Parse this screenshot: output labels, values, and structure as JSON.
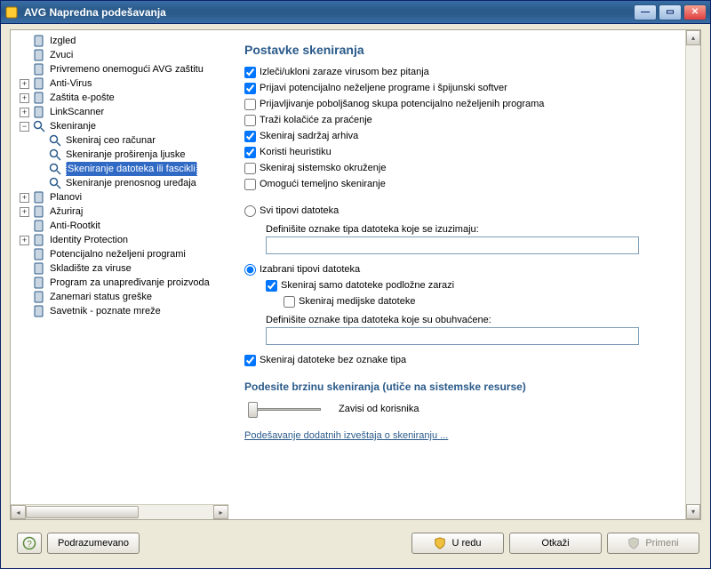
{
  "window": {
    "title": "AVG Napredna podešavanja"
  },
  "tree": [
    {
      "label": "Izgled",
      "depth": 0,
      "twisty": "",
      "icon": "doc"
    },
    {
      "label": "Zvuci",
      "depth": 0,
      "twisty": "",
      "icon": "doc"
    },
    {
      "label": "Privremeno onemogući AVG zaštitu",
      "depth": 0,
      "twisty": "",
      "icon": "doc"
    },
    {
      "label": "Anti-Virus",
      "depth": 0,
      "twisty": "+",
      "icon": "doc"
    },
    {
      "label": "Zaštita e-pošte",
      "depth": 0,
      "twisty": "+",
      "icon": "doc"
    },
    {
      "label": "LinkScanner",
      "depth": 0,
      "twisty": "+",
      "icon": "doc"
    },
    {
      "label": "Skeniranje",
      "depth": 0,
      "twisty": "−",
      "icon": "mag"
    },
    {
      "label": "Skeniraj ceo računar",
      "depth": 1,
      "twisty": "",
      "icon": "mag"
    },
    {
      "label": "Skeniranje proširenja ljuske",
      "depth": 1,
      "twisty": "",
      "icon": "mag"
    },
    {
      "label": "Skeniranje datoteka ili fascikli",
      "depth": 1,
      "twisty": "",
      "icon": "mag",
      "selected": true
    },
    {
      "label": "Skeniranje prenosnog uređaja",
      "depth": 1,
      "twisty": "",
      "icon": "mag"
    },
    {
      "label": "Planovi",
      "depth": 0,
      "twisty": "+",
      "icon": "doc"
    },
    {
      "label": "Ažuriraj",
      "depth": 0,
      "twisty": "+",
      "icon": "doc"
    },
    {
      "label": "Anti-Rootkit",
      "depth": 0,
      "twisty": "",
      "icon": "doc"
    },
    {
      "label": "Identity Protection",
      "depth": 0,
      "twisty": "+",
      "icon": "doc"
    },
    {
      "label": "Potencijalno neželjeni programi",
      "depth": 0,
      "twisty": "",
      "icon": "doc"
    },
    {
      "label": "Skladište za viruse",
      "depth": 0,
      "twisty": "",
      "icon": "doc"
    },
    {
      "label": "Program za unapređivanje proizvoda",
      "depth": 0,
      "twisty": "",
      "icon": "doc"
    },
    {
      "label": "Zanemari status greške",
      "depth": 0,
      "twisty": "",
      "icon": "doc"
    },
    {
      "label": "Savetnik - poznate mreže",
      "depth": 0,
      "twisty": "",
      "icon": "doc"
    }
  ],
  "settings": {
    "heading": "Postavke skeniranja",
    "checks": [
      {
        "label": "Izleči/ukloni zaraze virusom bez pitanja",
        "checked": true
      },
      {
        "label": "Prijavi potencijalno neželjene programe i špijunski softver",
        "checked": true
      },
      {
        "label": "Prijavljivanje poboljšanog skupa potencijalno neželjenih programa",
        "checked": false
      },
      {
        "label": "Traži kolačiće za praćenje",
        "checked": false
      },
      {
        "label": "Skeniraj sadržaj arhiva",
        "checked": true
      },
      {
        "label": "Koristi heuristiku",
        "checked": true
      },
      {
        "label": "Skeniraj sistemsko okruženje",
        "checked": false
      },
      {
        "label": "Omogući temeljno skeniranje",
        "checked": false
      }
    ],
    "radio_all": {
      "label": "Svi tipovi datoteka",
      "checked": false,
      "sublabel": "Definišite oznake tipa datoteka koje se izuzimaju:"
    },
    "radio_sel": {
      "label": "Izabrani tipovi datoteka",
      "checked": true,
      "chk_prone": {
        "label": "Skeniraj samo datoteke podložne zarazi",
        "checked": true
      },
      "chk_media": {
        "label": "Skeniraj medijske datoteke",
        "checked": false
      },
      "sublabel": "Definišite oznake tipa datoteka koje su obuhvaćene:"
    },
    "chk_noext": {
      "label": "Skeniraj datoteke bez oznake tipa",
      "checked": true
    },
    "speed": {
      "heading": "Podesite brzinu skeniranja (utiče na sistemske resurse)",
      "value_label": "Zavisi od korisnika"
    },
    "link": "Podešavanje dodatnih izveštaja o skeniranju ..."
  },
  "footer": {
    "default": "Podrazumevano",
    "ok": "U redu",
    "cancel": "Otkaži",
    "apply": "Primeni"
  }
}
